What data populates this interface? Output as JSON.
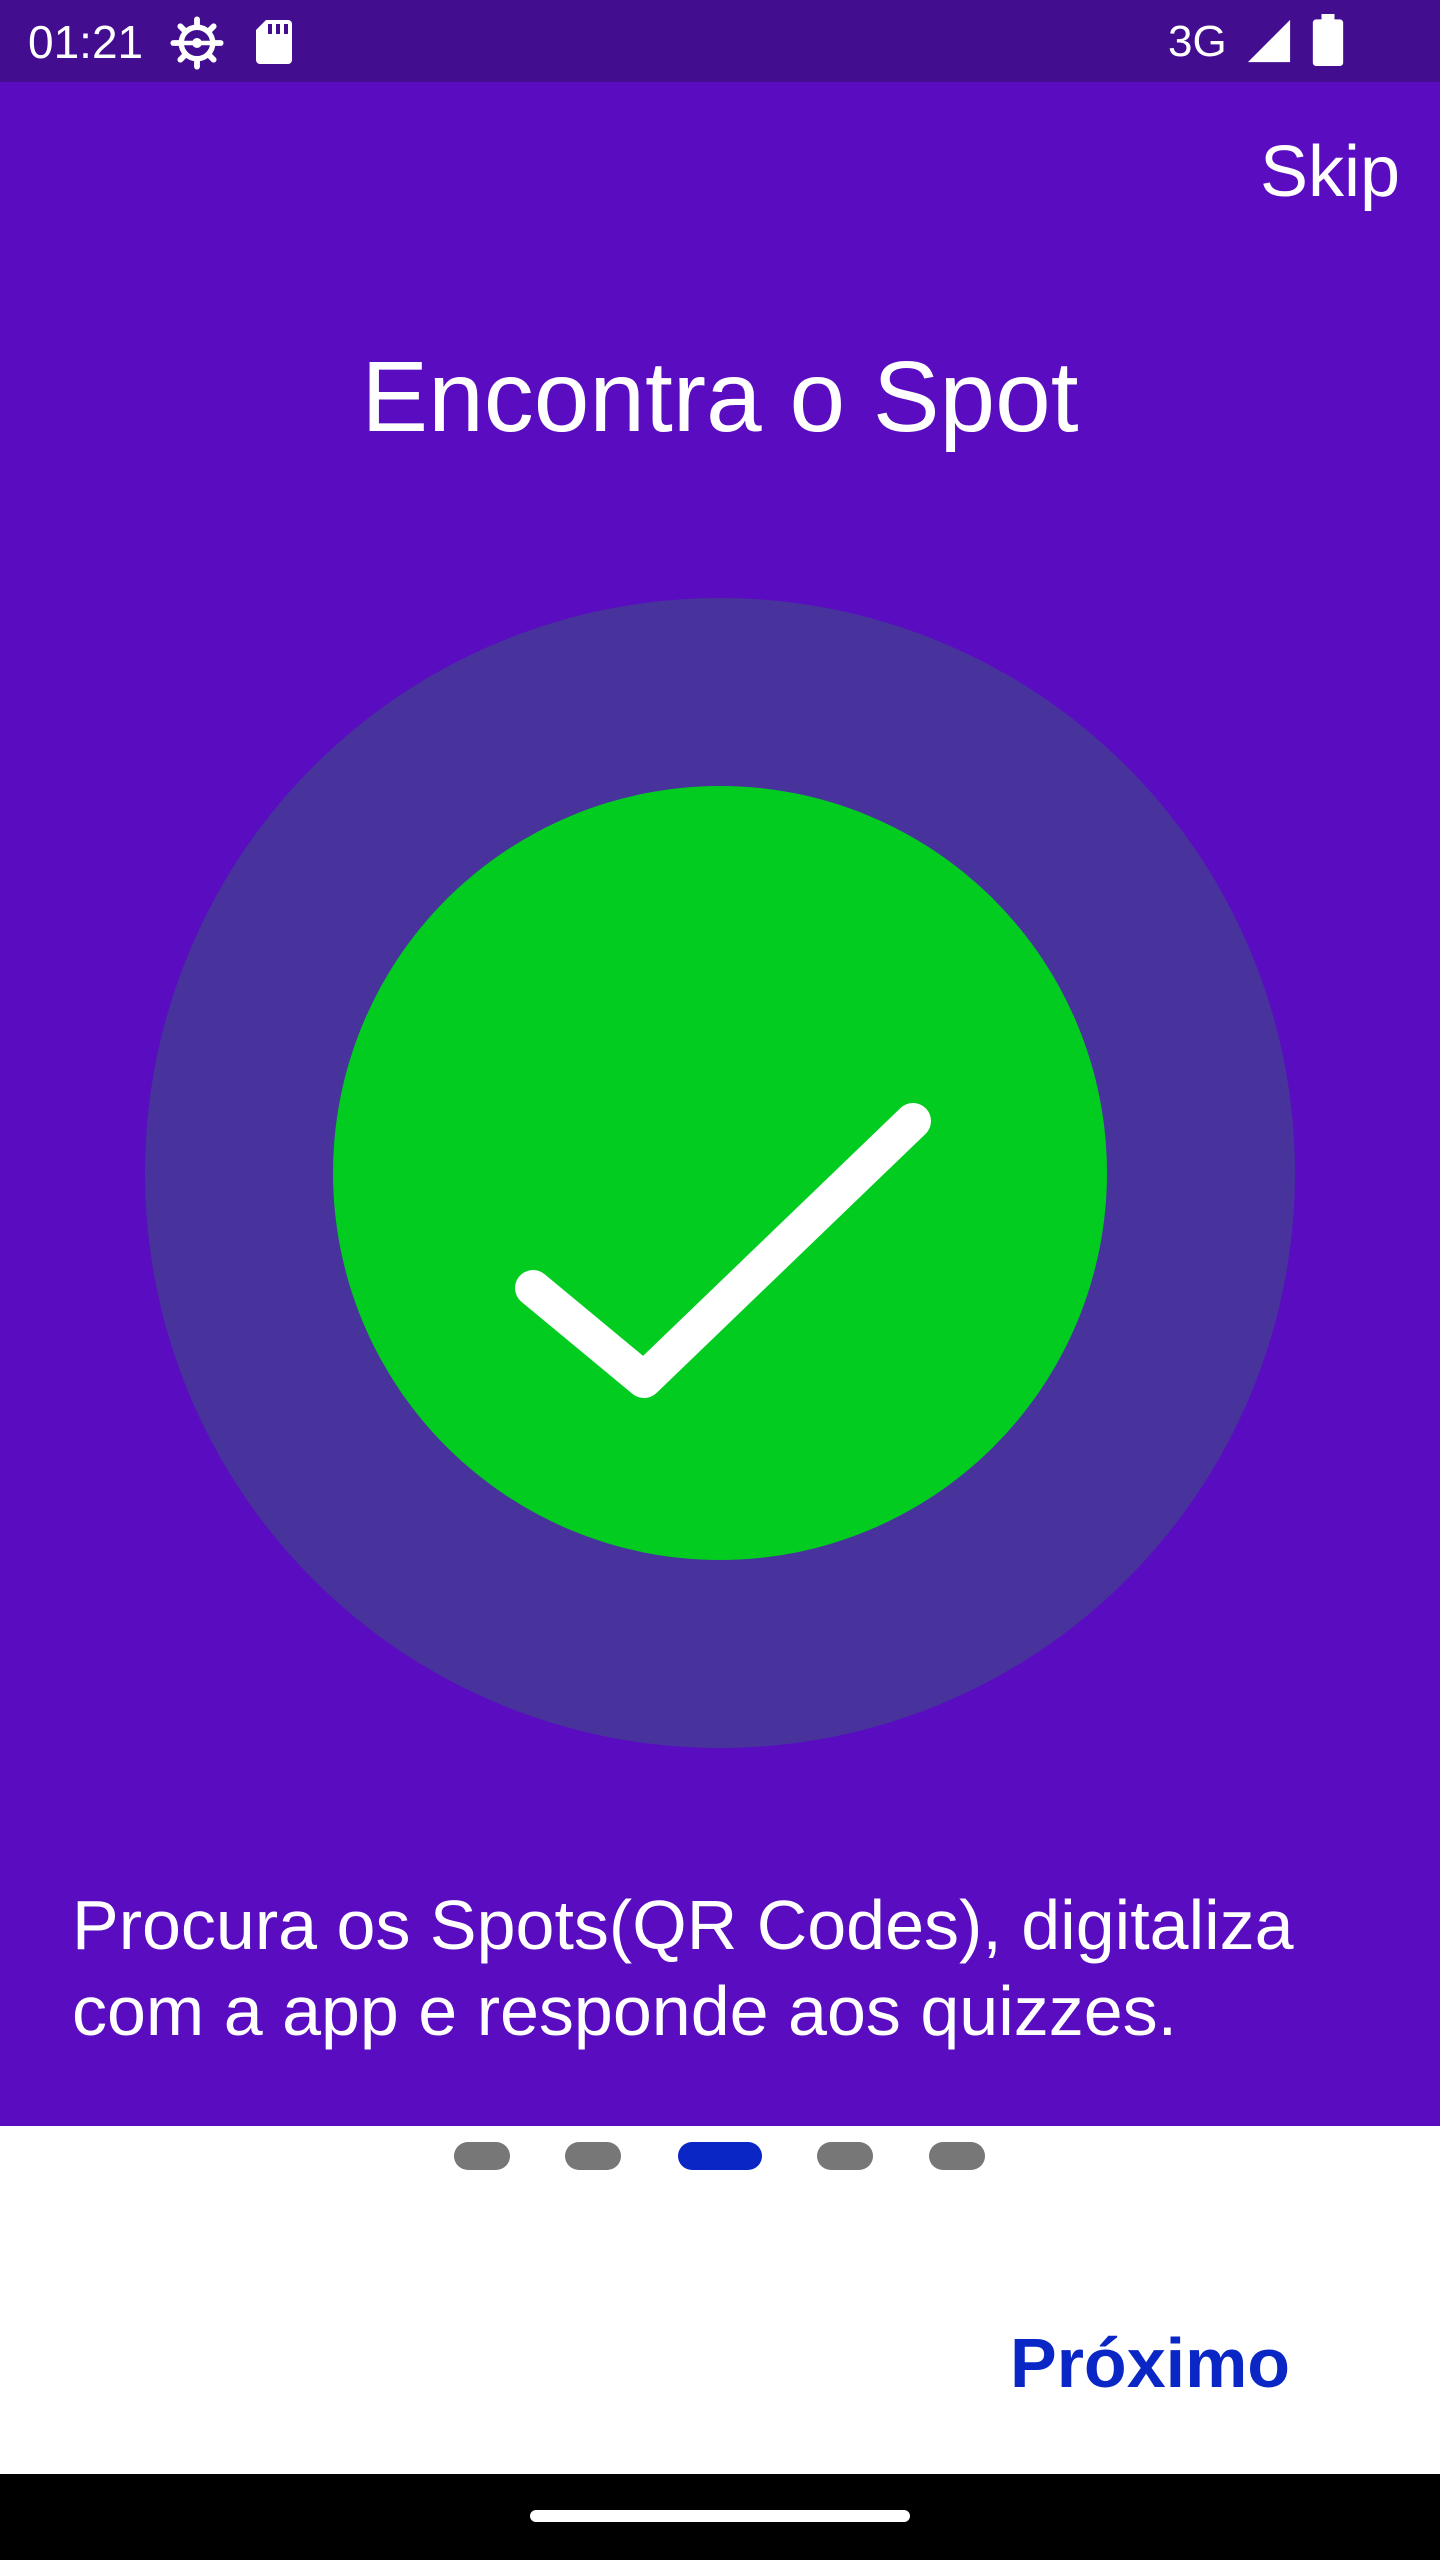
{
  "status_bar": {
    "time": "01:21",
    "network": "3G",
    "icons": [
      "settings-icon",
      "sd-card-icon",
      "signal-icon",
      "battery-icon"
    ],
    "background": "#420d8e"
  },
  "onboarding": {
    "skip_label": "Skip",
    "title": "Encontra o Spot",
    "description": "Procura os Spots(QR Codes), digitaliza com a app e responde aos quizzes.",
    "illustration_icon": "checkmark-icon",
    "background": "#5a0cc1",
    "outer_circle_color": "#48339c",
    "inner_circle_color": "#02cc20"
  },
  "pager": {
    "page_count": 5,
    "current_page": 3,
    "active_color": "#0a27c6",
    "inactive_color": "#777777"
  },
  "footer": {
    "next_label": "Próximo"
  }
}
